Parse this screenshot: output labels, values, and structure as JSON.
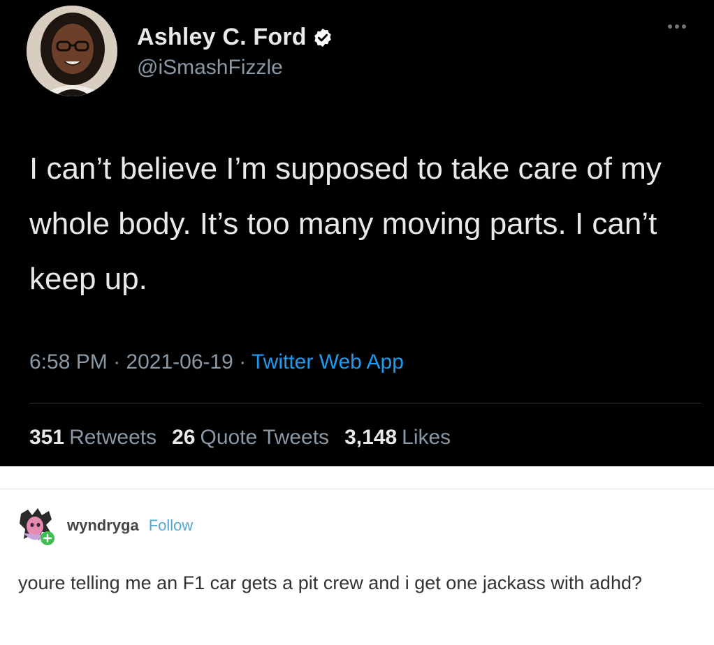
{
  "tweet": {
    "display_name": "Ashley C. Ford",
    "handle": "@iSmashFizzle",
    "verified_icon": "verified-badge-icon",
    "more_icon": "more-options-icon",
    "text": "I can’t believe I’m supposed to take care of my whole body. It’s too many moving parts. I can’t keep up.",
    "time": "6:58 PM",
    "date": "2021-06-19",
    "separator": "·",
    "source": "Twitter Web App",
    "stats": {
      "retweets_count": "351",
      "retweets_label": "Retweets",
      "quote_tweets_count": "26",
      "quote_tweets_label": "Quote Tweets",
      "likes_count": "3,148",
      "likes_label": "Likes"
    },
    "colors": {
      "background": "#000000",
      "text": "#e7e9ea",
      "secondary": "#8b98a5",
      "link": "#1d9bf0"
    }
  },
  "reply": {
    "username": "wyndryga",
    "follow_label": "Follow",
    "text": "youre telling me an F1 car gets a pit crew and i get one jackass with adhd?",
    "colors": {
      "follow": "#52a7d4",
      "text": "#333333"
    }
  }
}
